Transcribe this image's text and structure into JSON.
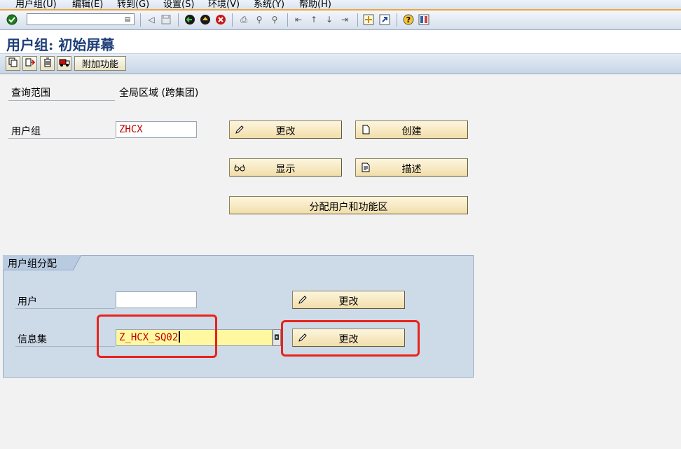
{
  "menubar": {
    "items": [
      {
        "label": "用户组(U)"
      },
      {
        "label": "编辑(E)"
      },
      {
        "label": "转到(G)"
      },
      {
        "label": "设置(S)"
      },
      {
        "label": "环境(V)"
      },
      {
        "label": "系统(Y)"
      },
      {
        "label": "帮助(H)"
      }
    ]
  },
  "toolbar": {
    "command_value": "",
    "icons": [
      "enter-check-icon",
      "command-dropdown-icon",
      "back-arrow-icon",
      "save-icon",
      "back-green-icon",
      "exit-yellow-icon",
      "cancel-red-icon",
      "print-icon",
      "find-icon",
      "find-next-icon",
      "first-page-icon",
      "previous-page-icon",
      "next-page-icon",
      "last-page-icon",
      "new-session-icon",
      "shortcut-icon",
      "help-icon",
      "layout-icon"
    ]
  },
  "title": "用户组: 初始屏幕",
  "app_toolbar": {
    "icons": [
      "copy-icon",
      "rename-icon",
      "delete-icon",
      "transport-icon"
    ],
    "extras_label": "附加功能"
  },
  "form": {
    "scope_label": "查询范围",
    "scope_value": "全局区域 (跨集团)",
    "group_label": "用户组",
    "group_value": "ZHCX",
    "buttons": {
      "change": "更改",
      "create": "创建",
      "display": "显示",
      "describe": "描述",
      "assign": "分配用户和功能区"
    }
  },
  "assignment": {
    "title": "用户组分配",
    "user_label": "用户",
    "user_value": "",
    "infoset_label": "信息集",
    "infoset_value": "Z_HCX_SQ02",
    "change_user": "更改",
    "change_infoset": "更改"
  },
  "colors": {
    "title": "#1f3f78",
    "input_text": "#c00000",
    "highlight_field": "#fff8a0",
    "button_bg": "#f1deaa",
    "group_bg": "#cddae8",
    "annotation_red": "#e8231a",
    "menu_accent": "#f1a53a"
  }
}
